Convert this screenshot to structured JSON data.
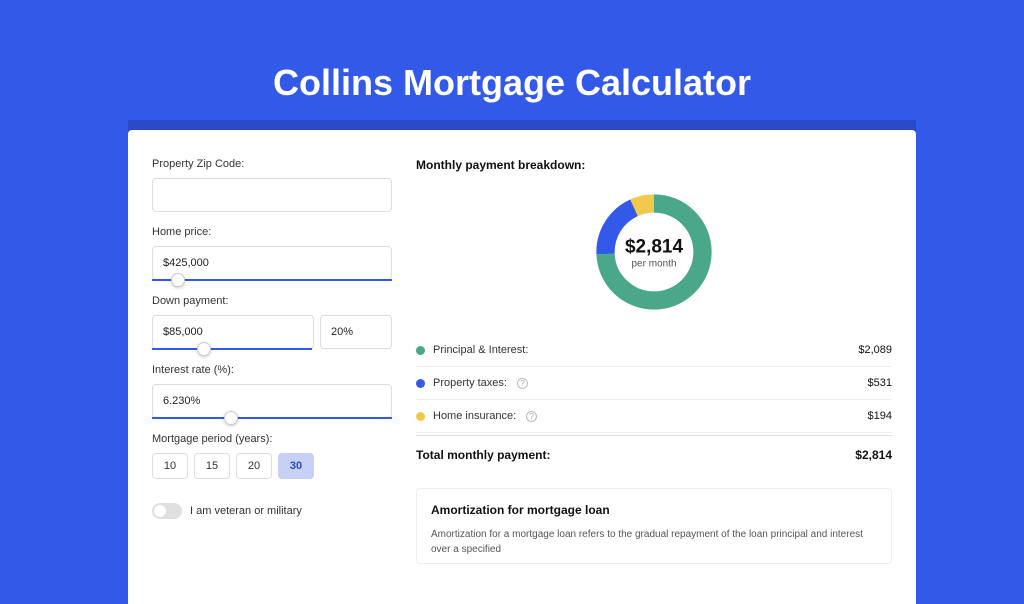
{
  "title": "Collins Mortgage Calculator",
  "form": {
    "zip_label": "Property Zip Code:",
    "zip_value": "",
    "home_price_label": "Home price:",
    "home_price_value": "$425,000",
    "down_payment_label": "Down payment:",
    "down_payment_value": "$85,000",
    "down_payment_pct_value": "20%",
    "interest_label": "Interest rate (%):",
    "interest_value": "6.230%",
    "period_label": "Mortgage period (years):",
    "period_options": [
      "10",
      "15",
      "20",
      "30"
    ],
    "period_selected": "30",
    "veteran_label": "I am veteran or military"
  },
  "breakdown": {
    "title": "Monthly payment breakdown:",
    "donut_amount": "$2,814",
    "donut_sub": "per month",
    "items": [
      {
        "label": "Principal & Interest:",
        "value": "$2,089",
        "color": "#4aa789",
        "help": false
      },
      {
        "label": "Property taxes:",
        "value": "$531",
        "color": "#3259e8",
        "help": true
      },
      {
        "label": "Home insurance:",
        "value": "$194",
        "color": "#f1c94b",
        "help": true
      }
    ],
    "total_label": "Total monthly payment:",
    "total_value": "$2,814"
  },
  "amortization": {
    "title": "Amortization for mortgage loan",
    "text": "Amortization for a mortgage loan refers to the gradual repayment of the loan principal and interest over a specified"
  },
  "chart_data": {
    "type": "pie",
    "title": "Monthly payment breakdown",
    "series": [
      {
        "name": "Principal & Interest",
        "value": 2089,
        "color": "#4aa789"
      },
      {
        "name": "Property taxes",
        "value": 531,
        "color": "#3259e8"
      },
      {
        "name": "Home insurance",
        "value": 194,
        "color": "#f1c94b"
      }
    ],
    "total": 2814,
    "center_label": "$2,814 per month",
    "hole": 0.66
  }
}
